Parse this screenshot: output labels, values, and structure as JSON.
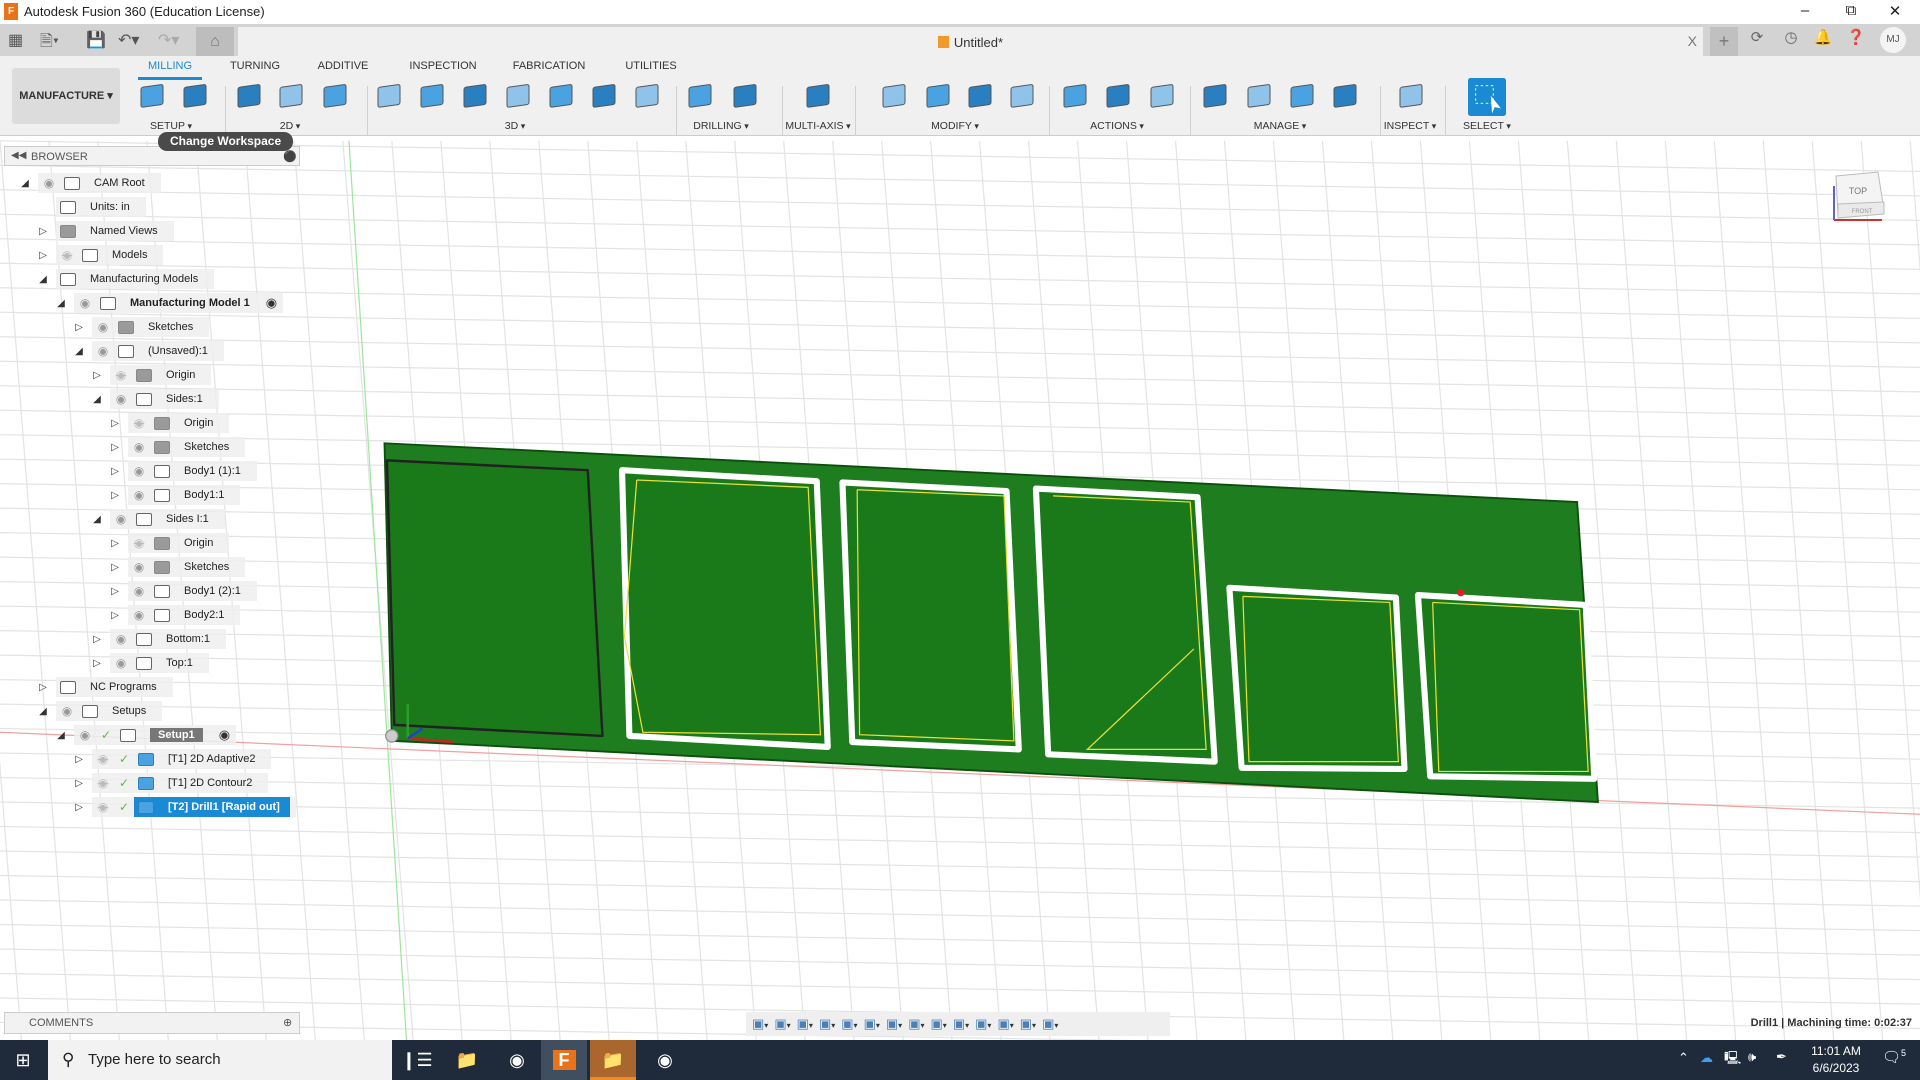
{
  "window": {
    "title": "Autodesk Fusion 360 (Education License)",
    "controls": [
      "minimize",
      "restore",
      "close"
    ]
  },
  "quick_access": {
    "icons": [
      "grid-menu-icon",
      "file-icon",
      "save-icon",
      "undo-icon",
      "redo-icon",
      "home-icon"
    ]
  },
  "document_tab": {
    "name": "Untitled*",
    "close": "X"
  },
  "top_right": {
    "icons": [
      "new-tab-icon",
      "extensions-icon",
      "job-status-icon",
      "notifications-icon",
      "help-icon"
    ],
    "avatar": "MJ"
  },
  "ribbon": {
    "workspace": "MANUFACTURE ▾",
    "tabs": [
      {
        "label": "MILLING",
        "active": true
      },
      {
        "label": "TURNING"
      },
      {
        "label": "ADDITIVE"
      },
      {
        "label": "INSPECTION"
      },
      {
        "label": "FABRICATION"
      },
      {
        "label": "UTILITIES"
      }
    ],
    "groups": [
      {
        "label": "SETUP",
        "icons": [
          "new-folder-icon",
          "nc-program-icon"
        ]
      },
      {
        "label": "2D",
        "icons": [
          "2d-adaptive-icon",
          "2d-pocket-icon",
          "2d-contour-icon"
        ]
      },
      {
        "label": "3D",
        "icons": [
          "3d-adaptive-icon",
          "3d-pocket-icon",
          "steep-shallow-icon",
          "horizontal-icon",
          "contour-icon",
          "parallel-icon",
          "scallop-icon"
        ]
      },
      {
        "label": "DRILLING",
        "icons": [
          "drill-icon",
          "hole-recognition-icon"
        ]
      },
      {
        "label": "MULTI-AXIS",
        "icons": [
          "multi-axis-icon"
        ]
      },
      {
        "label": "MODIFY",
        "icons": [
          "cut-icon",
          "delete-icon",
          "tool-icon",
          "pattern-icon"
        ]
      },
      {
        "label": "ACTIONS",
        "icons": [
          "simulate-gcode-icon",
          "setup-sheet-icon",
          "post-process-icon"
        ]
      },
      {
        "label": "MANAGE",
        "icons": [
          "tool-library-icon",
          "machine-library-icon",
          "post-library-icon",
          "template-library-icon"
        ]
      },
      {
        "label": "INSPECT",
        "icons": [
          "measure-icon"
        ]
      },
      {
        "label": "SELECT",
        "icons": [
          "select-icon"
        ]
      }
    ],
    "tooltip": "Change Workspace"
  },
  "browser": {
    "title": "BROWSER",
    "items": [
      {
        "level": 0,
        "expand": "open",
        "eye": "on",
        "icon": "component",
        "label": "CAM Root"
      },
      {
        "level": 1,
        "expand": "none",
        "eye": "none",
        "icon": "units",
        "label": "Units: in"
      },
      {
        "level": 1,
        "expand": "closed",
        "eye": "none",
        "icon": "folder",
        "label": "Named Views"
      },
      {
        "level": 1,
        "expand": "closed",
        "eye": "off",
        "icon": "component",
        "label": "Models"
      },
      {
        "level": 1,
        "expand": "open",
        "eye": "none",
        "icon": "component",
        "label": "Manufacturing Models"
      },
      {
        "level": 2,
        "expand": "open",
        "eye": "on",
        "icon": "component",
        "label": "Manufacturing Model 1",
        "bold": true,
        "target": true
      },
      {
        "level": 3,
        "expand": "closed",
        "eye": "on",
        "icon": "folder",
        "label": "Sketches"
      },
      {
        "level": 3,
        "expand": "open",
        "eye": "on",
        "icon": "component",
        "label": "(Unsaved):1"
      },
      {
        "level": 4,
        "expand": "closed",
        "eye": "off",
        "icon": "folder",
        "label": "Origin"
      },
      {
        "level": 4,
        "expand": "open",
        "eye": "on",
        "icon": "component",
        "label": "Sides:1"
      },
      {
        "level": 5,
        "expand": "closed",
        "eye": "off",
        "icon": "folder",
        "label": "Origin"
      },
      {
        "level": 5,
        "expand": "closed",
        "eye": "on",
        "icon": "folder",
        "label": "Sketches"
      },
      {
        "level": 5,
        "expand": "closed",
        "eye": "on",
        "icon": "body",
        "label": "Body1 (1):1"
      },
      {
        "level": 5,
        "expand": "closed",
        "eye": "on",
        "icon": "body",
        "label": "Body1:1"
      },
      {
        "level": 4,
        "expand": "open",
        "eye": "on",
        "icon": "component",
        "label": "Sides I:1"
      },
      {
        "level": 5,
        "expand": "closed",
        "eye": "off",
        "icon": "folder",
        "label": "Origin"
      },
      {
        "level": 5,
        "expand": "closed",
        "eye": "on",
        "icon": "folder",
        "label": "Sketches"
      },
      {
        "level": 5,
        "expand": "closed",
        "eye": "on",
        "icon": "body",
        "label": "Body1 (2):1"
      },
      {
        "level": 5,
        "expand": "closed",
        "eye": "on",
        "icon": "body",
        "label": "Body2:1"
      },
      {
        "level": 4,
        "expand": "closed",
        "eye": "on",
        "icon": "body",
        "label": "Bottom:1"
      },
      {
        "level": 4,
        "expand": "closed",
        "eye": "on",
        "icon": "body",
        "label": "Top:1"
      },
      {
        "level": 1,
        "expand": "closed",
        "eye": "none",
        "icon": "nc",
        "label": "NC Programs"
      },
      {
        "level": 1,
        "expand": "open",
        "eye": "on",
        "icon": "setup",
        "label": "Setups"
      },
      {
        "level": 2,
        "expand": "open",
        "eye": "on",
        "check": true,
        "icon": "setup",
        "label": "Setup1",
        "setup": true,
        "target": true
      },
      {
        "level": 3,
        "expand": "closed",
        "eye": "off",
        "check": true,
        "icon": "blue",
        "label": "[T1] 2D Adaptive2"
      },
      {
        "level": 3,
        "expand": "closed",
        "eye": "off",
        "check": true,
        "icon": "blue",
        "label": "[T1] 2D Contour2"
      },
      {
        "level": 3,
        "expand": "closed",
        "eye": "off",
        "check": true,
        "icon": "drill",
        "label": "[T2] Drill1 [Rapid out]",
        "selected": true
      }
    ]
  },
  "comments": {
    "title": "COMMENTS"
  },
  "navbar": {
    "icons": [
      "orbit-icon",
      "look-at-icon",
      "pan-icon",
      "zoom-icon",
      "zoom-window-icon",
      "display-settings-icon",
      "grid-icon",
      "viewports-icon",
      "effects-icon",
      "refresh-icon",
      "appearance-icon",
      "camera-icon",
      "tool-icon",
      "stock-icon"
    ]
  },
  "status": "Drill1 | Machining time: 0:02:37",
  "viewcube": {
    "top": "TOP",
    "front": "FRONT"
  },
  "taskbar": {
    "search_placeholder": "Type here to search",
    "time": "11:01 AM",
    "date": "6/6/2023",
    "notifications": "5"
  },
  "colors": {
    "accent": "#1a8ad4",
    "part_green": "#1e7d1e",
    "toolpath_yellow": "#e8e03a",
    "taskbar": "#1f2b3a"
  }
}
